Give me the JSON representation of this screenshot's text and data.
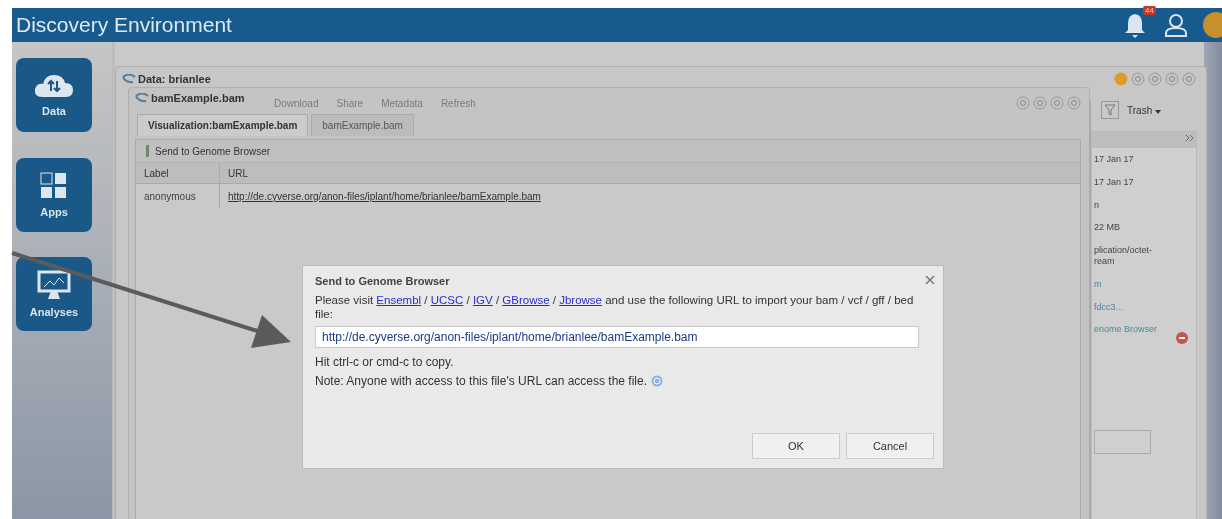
{
  "header": {
    "title": "Discovery Environment",
    "notification_count": "44"
  },
  "sidebar": {
    "items": [
      {
        "label": "Data",
        "kind": "data"
      },
      {
        "label": "Apps",
        "kind": "apps"
      },
      {
        "label": "Analyses",
        "kind": "analyses"
      }
    ]
  },
  "data_window": {
    "title": "Data: brianlee",
    "toolbar": [
      "Trash"
    ],
    "details": [
      "17 Jan 17",
      "17 Jan 17",
      "n",
      "22 MB",
      "plication/octet-\nream",
      "m",
      "fdcc3...",
      "enome Browser"
    ]
  },
  "viewer_window": {
    "title": "bamExample.bam",
    "toolbar": [
      "Download",
      "Share",
      "Metadata",
      "Refresh"
    ],
    "tabs": [
      {
        "label": "Visualization:bamExample.bam",
        "selected": true
      },
      {
        "label": "bamExample.bam",
        "selected": false
      }
    ],
    "action": "Send to Genome Browser",
    "table": {
      "columns": [
        "Label",
        "URL"
      ],
      "rows": [
        [
          "anonymous",
          "http://de.cyverse.org/anon-files/iplant/home/brianlee/bamExample.bam"
        ]
      ]
    }
  },
  "dialog": {
    "title": "Send to Genome Browser",
    "intro": [
      {
        "kind": "text",
        "text": "Please visit "
      },
      {
        "kind": "link",
        "text": "Ensembl"
      },
      {
        "kind": "text",
        "text": " / "
      },
      {
        "kind": "link",
        "text": "UCSC"
      },
      {
        "kind": "text",
        "text": " / "
      },
      {
        "kind": "link",
        "text": "IGV"
      },
      {
        "kind": "text",
        "text": " / "
      },
      {
        "kind": "link",
        "text": "GBrowse"
      },
      {
        "kind": "text",
        "text": " / "
      },
      {
        "kind": "link",
        "text": "Jbrowse"
      },
      {
        "kind": "text",
        "text": " and use the following URL to import your bam / vcf / gff / bed file:"
      }
    ],
    "url_field": {
      "value": "http://de.cyverse.org/anon-files/iplant/home/brianlee/bamExample.bam"
    },
    "hint": "Hit ctrl-c or cmd-c to copy.",
    "note": "Note: Anyone with access to this file's URL can access the file.",
    "buttons": [
      "OK",
      "Cancel"
    ]
  }
}
